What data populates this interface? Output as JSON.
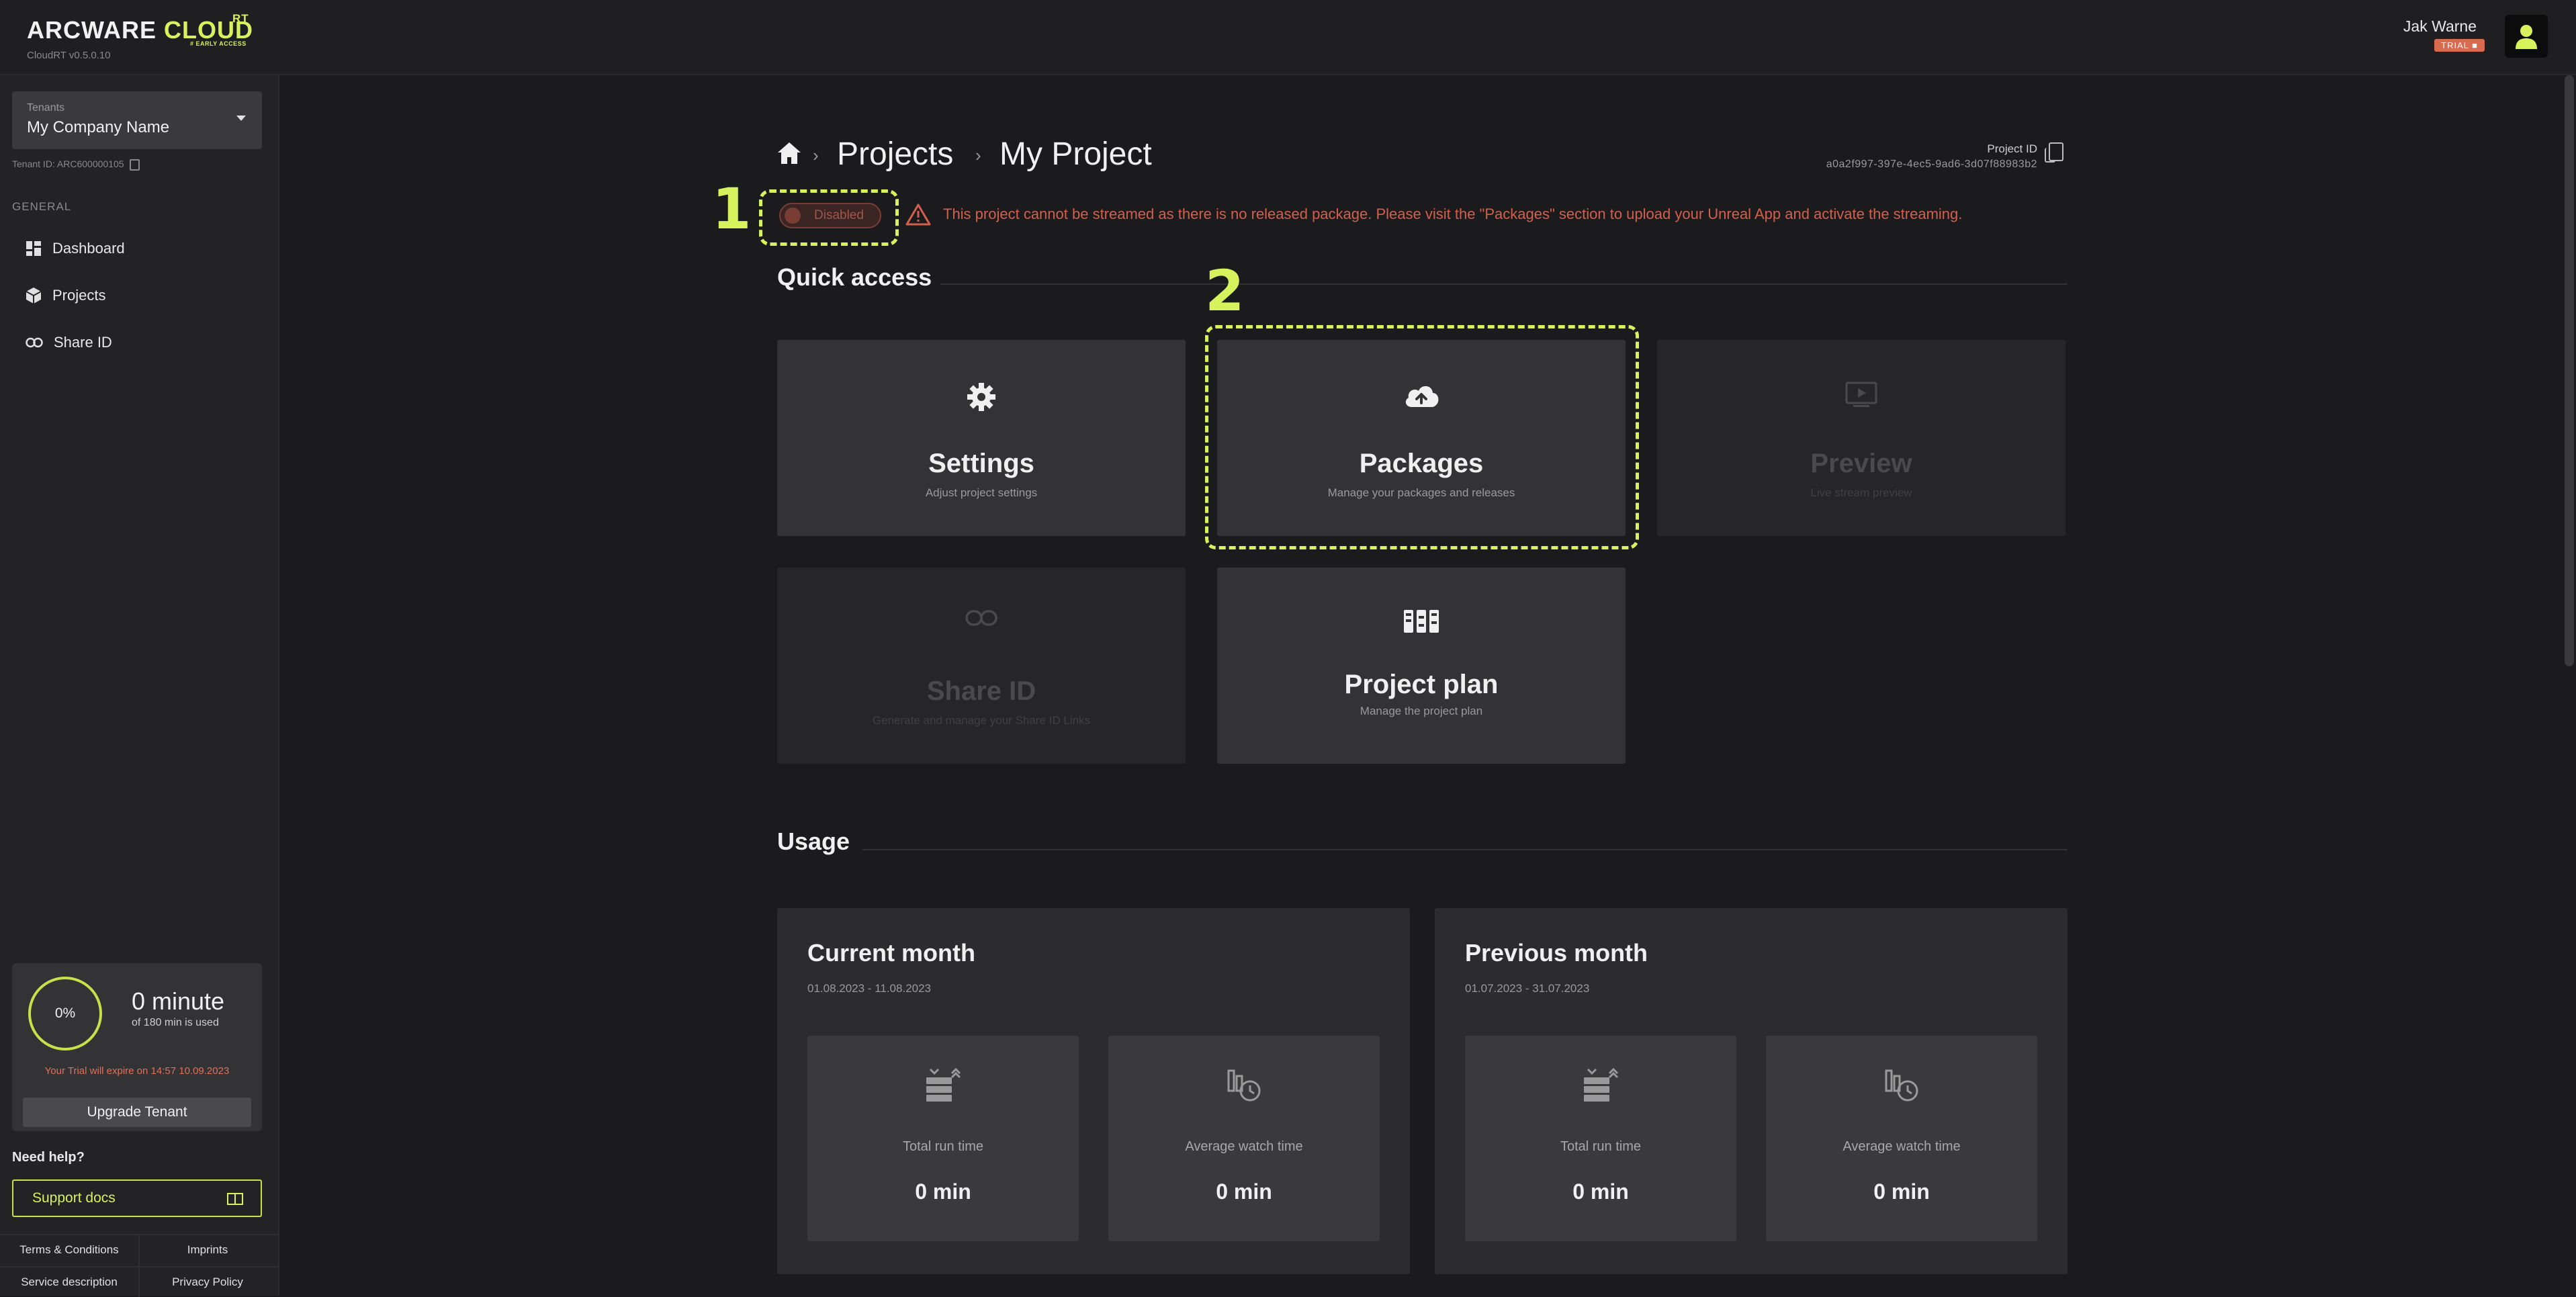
{
  "app": {
    "logo_main": "ARCWARE ",
    "logo_accent": "CLOUD",
    "logo_sup": "RT",
    "early_access": "# EARLY ACCESS",
    "version": "CloudRT v0.5.0.10"
  },
  "user": {
    "name": "Jak Warne",
    "badge": "TRIAL"
  },
  "sidebar": {
    "tenant_label": "Tenants",
    "tenant_name": "My Company Name",
    "tenant_id": "Tenant ID: ARC600000105",
    "section_label": "GENERAL",
    "items": [
      {
        "label": "Dashboard",
        "icon": "dashboard-icon"
      },
      {
        "label": "Projects",
        "icon": "box-icon"
      },
      {
        "label": "Share ID",
        "icon": "link-icon"
      }
    ],
    "usage": {
      "percent_label": "0%",
      "percent_value": 0,
      "minutes": "0 minute",
      "minutes_sub": "of 180 min is used",
      "trial_text": "Your Trial will expire on 14:57 10.09.2023",
      "upgrade_label": "Upgrade Tenant"
    },
    "need_help": "Need help?",
    "support_label": "Support docs",
    "footer": {
      "terms": "Terms & Conditions",
      "imprints": "Imprints",
      "service": "Service description",
      "privacy": "Privacy Policy"
    }
  },
  "breadcrumb": {
    "projects": "Projects",
    "project": "My Project"
  },
  "project_id": {
    "label": "Project ID",
    "value": "a0a2f997-397e-4ec5-9ad6-3d07f88983b2"
  },
  "stream_toggle": {
    "label": "Disabled",
    "enabled": false
  },
  "warning": "This project cannot be streamed as there is no released package. Please visit the \"Packages\" section to upload your Unreal App and activate the streaming.",
  "quick_access": {
    "title": "Quick access",
    "tiles": [
      {
        "title": "Settings",
        "subtitle": "Adjust project settings",
        "icon": "gear-icon",
        "enabled": true
      },
      {
        "title": "Packages",
        "subtitle": "Manage your packages and releases",
        "icon": "cloud-upload-icon",
        "enabled": true
      },
      {
        "title": "Preview",
        "subtitle": "Live stream preview",
        "icon": "play-screen-icon",
        "enabled": false
      },
      {
        "title": "Share ID",
        "subtitle": "Generate and manage your Share ID Links",
        "icon": "link-icon",
        "enabled": false
      },
      {
        "title": "Project plan",
        "subtitle": "Manage the project plan",
        "icon": "plan-icon",
        "enabled": true
      }
    ]
  },
  "annotations": {
    "marker_1": "1",
    "marker_2": "2"
  },
  "usage": {
    "title": "Usage",
    "panels": [
      {
        "title": "Current month",
        "date_range": "01.08.2023 - 11.08.2023",
        "stats": [
          {
            "label": "Total run time",
            "value": "0 min",
            "icon": "server-icon"
          },
          {
            "label": "Average watch time",
            "value": "0 min",
            "icon": "watch-time-icon"
          }
        ]
      },
      {
        "title": "Previous month",
        "date_range": "01.07.2023 - 31.07.2023",
        "stats": [
          {
            "label": "Total run time",
            "value": "0 min",
            "icon": "server-icon"
          },
          {
            "label": "Average watch time",
            "value": "0 min",
            "icon": "watch-time-icon"
          }
        ]
      }
    ]
  },
  "colors": {
    "accent": "#d7f25c",
    "warning": "#d2604c",
    "background": "#1b1b1d",
    "card": "#333335"
  }
}
